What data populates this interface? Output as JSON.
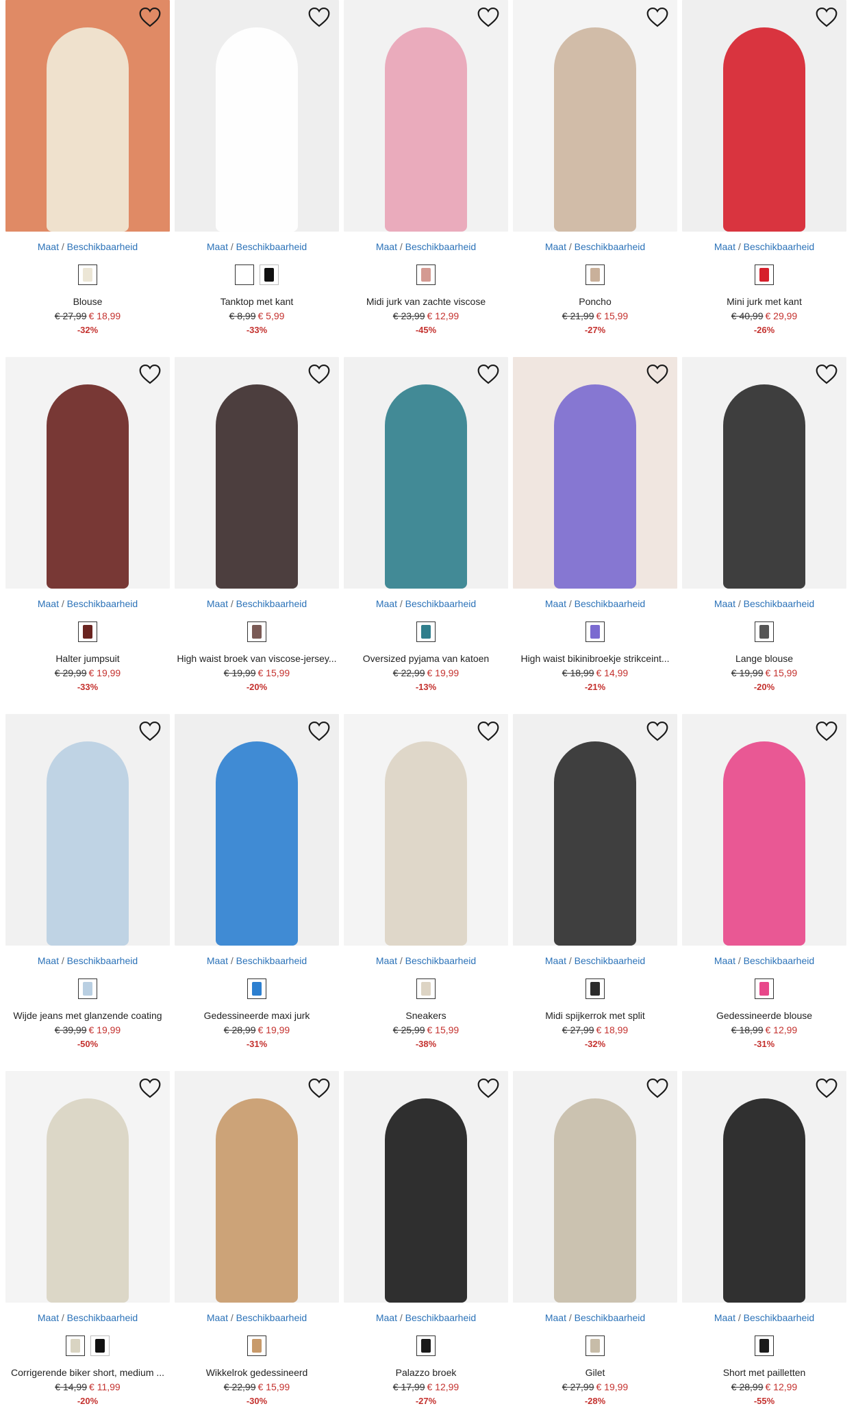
{
  "availability_label_a": "Maat",
  "availability_sep": " / ",
  "availability_label_b": "Beschikbaarheid",
  "products": [
    {
      "name": "Blouse",
      "old_price": "€ 27,99",
      "new_price": "€ 18,99",
      "discount": "-32%",
      "bg": "#e08a65",
      "fig": "#f1ead8",
      "swatches": [
        "#ece6d6"
      ]
    },
    {
      "name": "Tanktop met kant",
      "old_price": "€ 8,99",
      "new_price": "€ 5,99",
      "discount": "-33%",
      "bg": "#eeeeee",
      "fig": "#ffffff",
      "swatches": [
        "#ffffff",
        "#111111"
      ]
    },
    {
      "name": "Midi jurk van zachte viscose",
      "old_price": "€ 23,99",
      "new_price": "€ 12,99",
      "discount": "-45%",
      "bg": "#f2f2f2",
      "fig": "#e9a3b6",
      "swatches": [
        "#d49a92"
      ]
    },
    {
      "name": "Poncho",
      "old_price": "€ 21,99",
      "new_price": "€ 15,99",
      "discount": "-27%",
      "bg": "#f4f4f4",
      "fig": "#cdb6a0",
      "swatches": [
        "#c9b09a"
      ]
    },
    {
      "name": "Mini jurk met kant",
      "old_price": "€ 40,99",
      "new_price": "€ 29,99",
      "discount": "-26%",
      "bg": "#efefef",
      "fig": "#d61f2b",
      "swatches": [
        "#d61f2b"
      ]
    },
    {
      "name": "Halter jumpsuit",
      "old_price": "€ 29,99",
      "new_price": "€ 19,99",
      "discount": "-33%",
      "bg": "#f3f3f3",
      "fig": "#6a2420",
      "swatches": [
        "#6a2420"
      ]
    },
    {
      "name": "High waist broek van viscose-jersey...",
      "old_price": "€ 19,99",
      "new_price": "€ 15,99",
      "discount": "-20%",
      "bg": "#f2f2f2",
      "fig": "#3a2a2a",
      "swatches": [
        "#7a5a55"
      ]
    },
    {
      "name": "Oversized pyjama van katoen",
      "old_price": "€ 22,99",
      "new_price": "€ 19,99",
      "discount": "-13%",
      "bg": "#f1f1f1",
      "fig": "#2f7e8c",
      "swatches": [
        "#2f7e8c"
      ]
    },
    {
      "name": "High waist bikinibroekje strikceint...",
      "old_price": "€ 18,99",
      "new_price": "€ 14,99",
      "discount": "-21%",
      "bg": "#f0e6e0",
      "fig": "#7a6ad0",
      "swatches": [
        "#7a6ad0"
      ]
    },
    {
      "name": "Lange blouse",
      "old_price": "€ 19,99",
      "new_price": "€ 15,99",
      "discount": "-20%",
      "bg": "#f2f2f2",
      "fig": "#2a2a2a",
      "swatches": [
        "#555555"
      ]
    },
    {
      "name": "Wijde jeans met glanzende coating",
      "old_price": "€ 39,99",
      "new_price": "€ 19,99",
      "discount": "-50%",
      "bg": "#f1f1f1",
      "fig": "#b9cfe2",
      "swatches": [
        "#b9cfe2"
      ]
    },
    {
      "name": "Gedessineerde maxi jurk",
      "old_price": "€ 28,99",
      "new_price": "€ 19,99",
      "discount": "-31%",
      "bg": "#efefef",
      "fig": "#2c7fd0",
      "swatches": [
        "#2c7fd0"
      ]
    },
    {
      "name": "Sneakers",
      "old_price": "€ 25,99",
      "new_price": "€ 15,99",
      "discount": "-38%",
      "bg": "#f4f4f4",
      "fig": "#ddd4c4",
      "swatches": [
        "#ddd4c4"
      ]
    },
    {
      "name": "Midi spijkerrok met split",
      "old_price": "€ 27,99",
      "new_price": "€ 18,99",
      "discount": "-32%",
      "bg": "#f0f0f0",
      "fig": "#2b2b2b",
      "swatches": [
        "#2b2b2b"
      ]
    },
    {
      "name": "Gedessineerde blouse",
      "old_price": "€ 18,99",
      "new_price": "€ 12,99",
      "discount": "-31%",
      "bg": "#f2f2f2",
      "fig": "#e8478a",
      "swatches": [
        "#e8478a"
      ]
    },
    {
      "name": "Corrigerende biker short, medium ...",
      "old_price": "€ 14,99",
      "new_price": "€ 11,99",
      "discount": "-20%",
      "bg": "#f4f4f4",
      "fig": "#d9d4c2",
      "swatches": [
        "#d9d4c2",
        "#111111"
      ]
    },
    {
      "name": "Wikkelrok gedessineerd",
      "old_price": "€ 22,99",
      "new_price": "€ 15,99",
      "discount": "-30%",
      "bg": "#f2f2f2",
      "fig": "#c89a6a",
      "swatches": [
        "#c89a6a"
      ]
    },
    {
      "name": "Palazzo broek",
      "old_price": "€ 17,99",
      "new_price": "€ 12,99",
      "discount": "-27%",
      "bg": "#f2f2f2",
      "fig": "#1a1a1a",
      "swatches": [
        "#1a1a1a"
      ]
    },
    {
      "name": "Gilet",
      "old_price": "€ 27,99",
      "new_price": "€ 19,99",
      "discount": "-28%",
      "bg": "#f2f2f2",
      "fig": "#c7bca8",
      "swatches": [
        "#c7bca8"
      ]
    },
    {
      "name": "Short met pailletten",
      "old_price": "€ 28,99",
      "new_price": "€ 12,99",
      "discount": "-55%",
      "bg": "#f2f2f2",
      "fig": "#1b1b1b",
      "swatches": [
        "#1b1b1b"
      ]
    }
  ]
}
